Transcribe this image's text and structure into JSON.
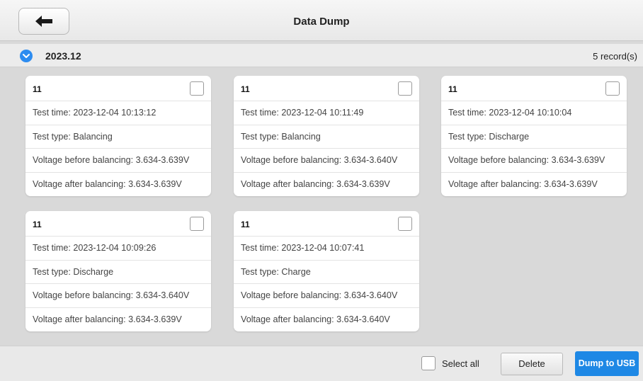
{
  "header": {
    "title": "Data Dump",
    "back_icon": "arrow-left-icon"
  },
  "group": {
    "title": "2023.12",
    "count": "5 record(s)",
    "expanded_icon": "chevron-down-icon",
    "accent_color": "#2d8cf0"
  },
  "records": [
    {
      "name": "11",
      "test_time": "Test time: 2023-12-04 10:13:12",
      "test_type": "Test type: Balancing",
      "voltage_before": "Voltage before balancing: 3.634-3.639V",
      "voltage_after": "Voltage after balancing: 3.634-3.639V",
      "checked": false
    },
    {
      "name": "11",
      "test_time": "Test time: 2023-12-04 10:11:49",
      "test_type": "Test type: Balancing",
      "voltage_before": "Voltage before balancing: 3.634-3.640V",
      "voltage_after": "Voltage after balancing: 3.634-3.639V",
      "checked": false
    },
    {
      "name": "11",
      "test_time": "Test time: 2023-12-04 10:10:04",
      "test_type": "Test type: Discharge",
      "voltage_before": "Voltage before balancing: 3.634-3.639V",
      "voltage_after": "Voltage after balancing: 3.634-3.639V",
      "checked": false
    },
    {
      "name": "11",
      "test_time": "Test time: 2023-12-04 10:09:26",
      "test_type": "Test type: Discharge",
      "voltage_before": "Voltage before balancing: 3.634-3.640V",
      "voltage_after": "Voltage after balancing: 3.634-3.639V",
      "checked": false
    },
    {
      "name": "11",
      "test_time": "Test time: 2023-12-04 10:07:41",
      "test_type": "Test type: Charge",
      "voltage_before": "Voltage before balancing: 3.634-3.640V",
      "voltage_after": "Voltage after balancing: 3.634-3.640V",
      "checked": false
    }
  ],
  "footer": {
    "select_all_label": "Select all",
    "delete_label": "Delete",
    "dump_label": "Dump to USB",
    "dump_color": "#1e88e5"
  }
}
